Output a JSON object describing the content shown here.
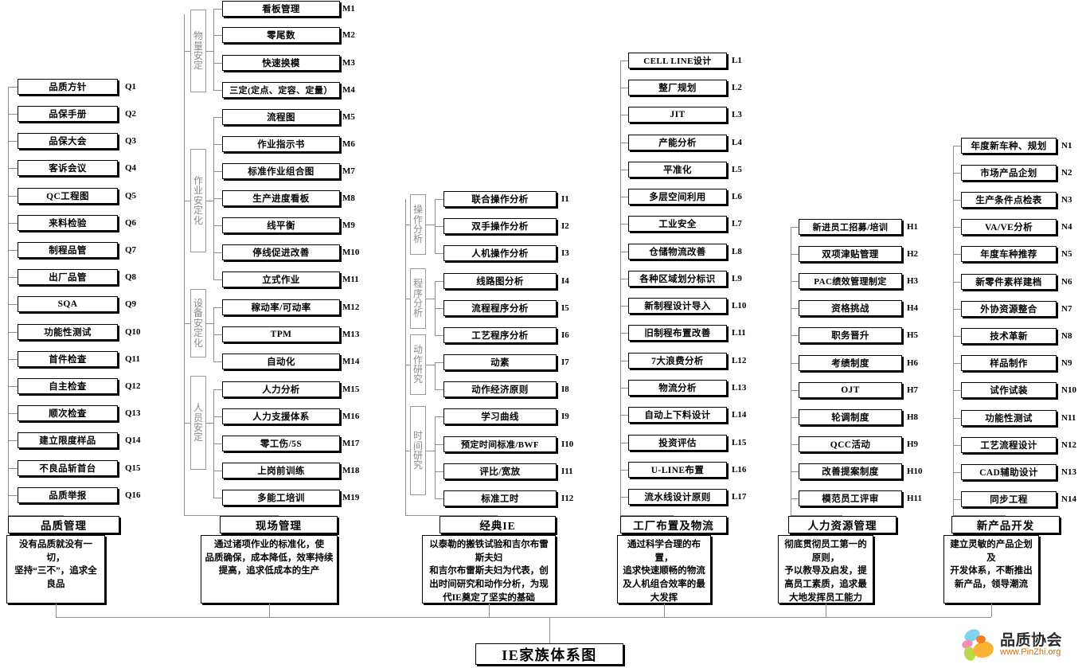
{
  "title": "IE家族体系图",
  "logo": {
    "name": "品质协会",
    "url": "www.PinZhi.org",
    "icon": "pinzhi-logo-icon"
  },
  "columns": [
    {
      "id": "Q",
      "head": "品质管理",
      "desc_line1": "没有品质就没有一切，",
      "desc_line2": "坚持“三不”，追求全良品",
      "groups": [],
      "items": [
        {
          "code": "Q1",
          "label": "品质方针"
        },
        {
          "code": "Q2",
          "label": "品保手册"
        },
        {
          "code": "Q3",
          "label": "品保大会"
        },
        {
          "code": "Q4",
          "label": "客诉会议"
        },
        {
          "code": "Q5",
          "label": "QC工程图"
        },
        {
          "code": "Q6",
          "label": "来料检验"
        },
        {
          "code": "Q7",
          "label": "制程品管"
        },
        {
          "code": "Q8",
          "label": "出厂品管"
        },
        {
          "code": "Q9",
          "label": "SQA"
        },
        {
          "code": "Q10",
          "label": "功能性测试"
        },
        {
          "code": "Q11",
          "label": "首件检查"
        },
        {
          "code": "Q12",
          "label": "自主检查"
        },
        {
          "code": "Q13",
          "label": "顺次检查"
        },
        {
          "code": "Q14",
          "label": "建立限度样品"
        },
        {
          "code": "Q15",
          "label": "不良品斩首台"
        },
        {
          "code": "Q16",
          "label": "品质举报"
        }
      ]
    },
    {
      "id": "M",
      "head": "现场管理",
      "desc_line1": "通过诸项作业的标准化，使",
      "desc_line2": "品质确保，成本降低，效率持续提高，追求低成本的生产",
      "groups": [
        {
          "label": "物量安定",
          "items": [
            "M1",
            "M2",
            "M3",
            "M4"
          ]
        },
        {
          "label": "作业安定化",
          "items": [
            "M5",
            "M6",
            "M7",
            "M8",
            "M9",
            "M10",
            "M11"
          ]
        },
        {
          "label": "设备安定化",
          "items": [
            "M12",
            "M13",
            "M14"
          ]
        },
        {
          "label": "人员安定",
          "items": [
            "M15",
            "M16",
            "M17",
            "M18",
            "M19"
          ]
        }
      ],
      "items": [
        {
          "code": "M1",
          "label": "看板管理"
        },
        {
          "code": "M2",
          "label": "零尾数"
        },
        {
          "code": "M3",
          "label": "快速换模"
        },
        {
          "code": "M4",
          "label": "三定(定点、定容、定量）"
        },
        {
          "code": "M5",
          "label": "流程图"
        },
        {
          "code": "M6",
          "label": "作业指示书"
        },
        {
          "code": "M7",
          "label": "标准作业组合图"
        },
        {
          "code": "M8",
          "label": "生产进度看板"
        },
        {
          "code": "M9",
          "label": "线平衡"
        },
        {
          "code": "M10",
          "label": "停线促进改善"
        },
        {
          "code": "M11",
          "label": "立式作业"
        },
        {
          "code": "M12",
          "label": "稼动率/可动率"
        },
        {
          "code": "M13",
          "label": "TPM"
        },
        {
          "code": "M14",
          "label": "自动化"
        },
        {
          "code": "M15",
          "label": "人力分析"
        },
        {
          "code": "M16",
          "label": "人力支援体系"
        },
        {
          "code": "M17",
          "label": "零工伤/5S"
        },
        {
          "code": "M18",
          "label": "上岗前训练"
        },
        {
          "code": "M19",
          "label": "多能工培训"
        }
      ]
    },
    {
      "id": "I",
      "head": "经典IE",
      "desc_line1": "以泰勒的搬铁试验和吉尔布雷斯夫妇",
      "desc_line2": "和吉尔布雷斯夫妇为代表，创出时间研究和动作分析，为现代IE奠定了坚实的基础",
      "groups": [
        {
          "label": "操作分析",
          "items": [
            "I1",
            "I2",
            "I3"
          ]
        },
        {
          "label": "程序分析",
          "items": [
            "I4",
            "I5",
            "I6"
          ]
        },
        {
          "label": "动作研究",
          "items": [
            "I7",
            "I8"
          ]
        },
        {
          "label": "时间研究",
          "items": [
            "I9",
            "I10",
            "I11",
            "I12"
          ]
        }
      ],
      "items": [
        {
          "code": "I1",
          "label": "联合操作分析"
        },
        {
          "code": "I2",
          "label": "双手操作分析"
        },
        {
          "code": "I3",
          "label": "人机操作分析"
        },
        {
          "code": "I4",
          "label": "线路图分析"
        },
        {
          "code": "I5",
          "label": "流程程序分析"
        },
        {
          "code": "I6",
          "label": "工艺程序分析"
        },
        {
          "code": "I7",
          "label": "动素"
        },
        {
          "code": "I8",
          "label": "动作经济原则"
        },
        {
          "code": "I9",
          "label": "学习曲线"
        },
        {
          "code": "I10",
          "label": "预定时间标准/BWF"
        },
        {
          "code": "I11",
          "label": "评比/宽放"
        },
        {
          "code": "I12",
          "label": "标准工时"
        }
      ]
    },
    {
      "id": "L",
      "head": "工厂布置及物流",
      "desc_line1": "通过科学合理的布置，",
      "desc_line2": "追求快速顺畅的物流及人机组合效率的最大发挥",
      "groups": [],
      "items": [
        {
          "code": "L1",
          "label": "CELL  LINE设计"
        },
        {
          "code": "L2",
          "label": "整厂规划"
        },
        {
          "code": "L3",
          "label": "JIT"
        },
        {
          "code": "L4",
          "label": "产能分析"
        },
        {
          "code": "L5",
          "label": "平准化"
        },
        {
          "code": "L6",
          "label": "多层空间利用"
        },
        {
          "code": "L7",
          "label": "工业安全"
        },
        {
          "code": "L8",
          "label": "仓储物流改善"
        },
        {
          "code": "L9",
          "label": "各种区域划分标识"
        },
        {
          "code": "L10",
          "label": "新制程设计导入"
        },
        {
          "code": "L11",
          "label": "旧制程布置改善"
        },
        {
          "code": "L12",
          "label": "7大浪费分析"
        },
        {
          "code": "L13",
          "label": "物流分析"
        },
        {
          "code": "L14",
          "label": "自动上下料设计"
        },
        {
          "code": "L15",
          "label": "投资评估"
        },
        {
          "code": "L16",
          "label": "U-LINE布置"
        },
        {
          "code": "L17",
          "label": "流水线设计原则"
        }
      ]
    },
    {
      "id": "H",
      "head": "人力资源管理",
      "desc_line1": "彻底贯彻员工第一的原则，",
      "desc_line2": "予以教导及启发，提高员工素质，追求最大地发挥员工能力",
      "groups": [],
      "items": [
        {
          "code": "H1",
          "label": "新进员工招募/培训"
        },
        {
          "code": "H2",
          "label": "双项津贴管理"
        },
        {
          "code": "H3",
          "label": "PAC绩效管理制定"
        },
        {
          "code": "H4",
          "label": "资格挑战"
        },
        {
          "code": "H5",
          "label": "职务晋升"
        },
        {
          "code": "H6",
          "label": "考绩制度"
        },
        {
          "code": "H7",
          "label": "OJT"
        },
        {
          "code": "H8",
          "label": "轮调制度"
        },
        {
          "code": "H9",
          "label": "QCC活动"
        },
        {
          "code": "H10",
          "label": "改善提案制度"
        },
        {
          "code": "H11",
          "label": "模范员工评审"
        }
      ]
    },
    {
      "id": "N",
      "head": "新产品开发",
      "desc_line1": "建立灵敏的产品企划及",
      "desc_line2": "开发体系，不断推出新产品，领导潮流",
      "groups": [],
      "items": [
        {
          "code": "N1",
          "label": "年度新车种、规划"
        },
        {
          "code": "N2",
          "label": "市场产品企划"
        },
        {
          "code": "N3",
          "label": "生产条件点检表"
        },
        {
          "code": "N4",
          "label": "VA/VE分析"
        },
        {
          "code": "N5",
          "label": "年度车种推荐"
        },
        {
          "code": "N6",
          "label": "新零件素样建档"
        },
        {
          "code": "N7",
          "label": "外协资源整合"
        },
        {
          "code": "N8",
          "label": "技术革新"
        },
        {
          "code": "N9",
          "label": "样品制作"
        },
        {
          "code": "N10",
          "label": "试作试装"
        },
        {
          "code": "N11",
          "label": "功能性测试"
        },
        {
          "code": "N12",
          "label": "工艺流程设计"
        },
        {
          "code": "N13",
          "label": "CAD辅助设计"
        },
        {
          "code": "N14",
          "label": "同步工程"
        }
      ]
    }
  ]
}
